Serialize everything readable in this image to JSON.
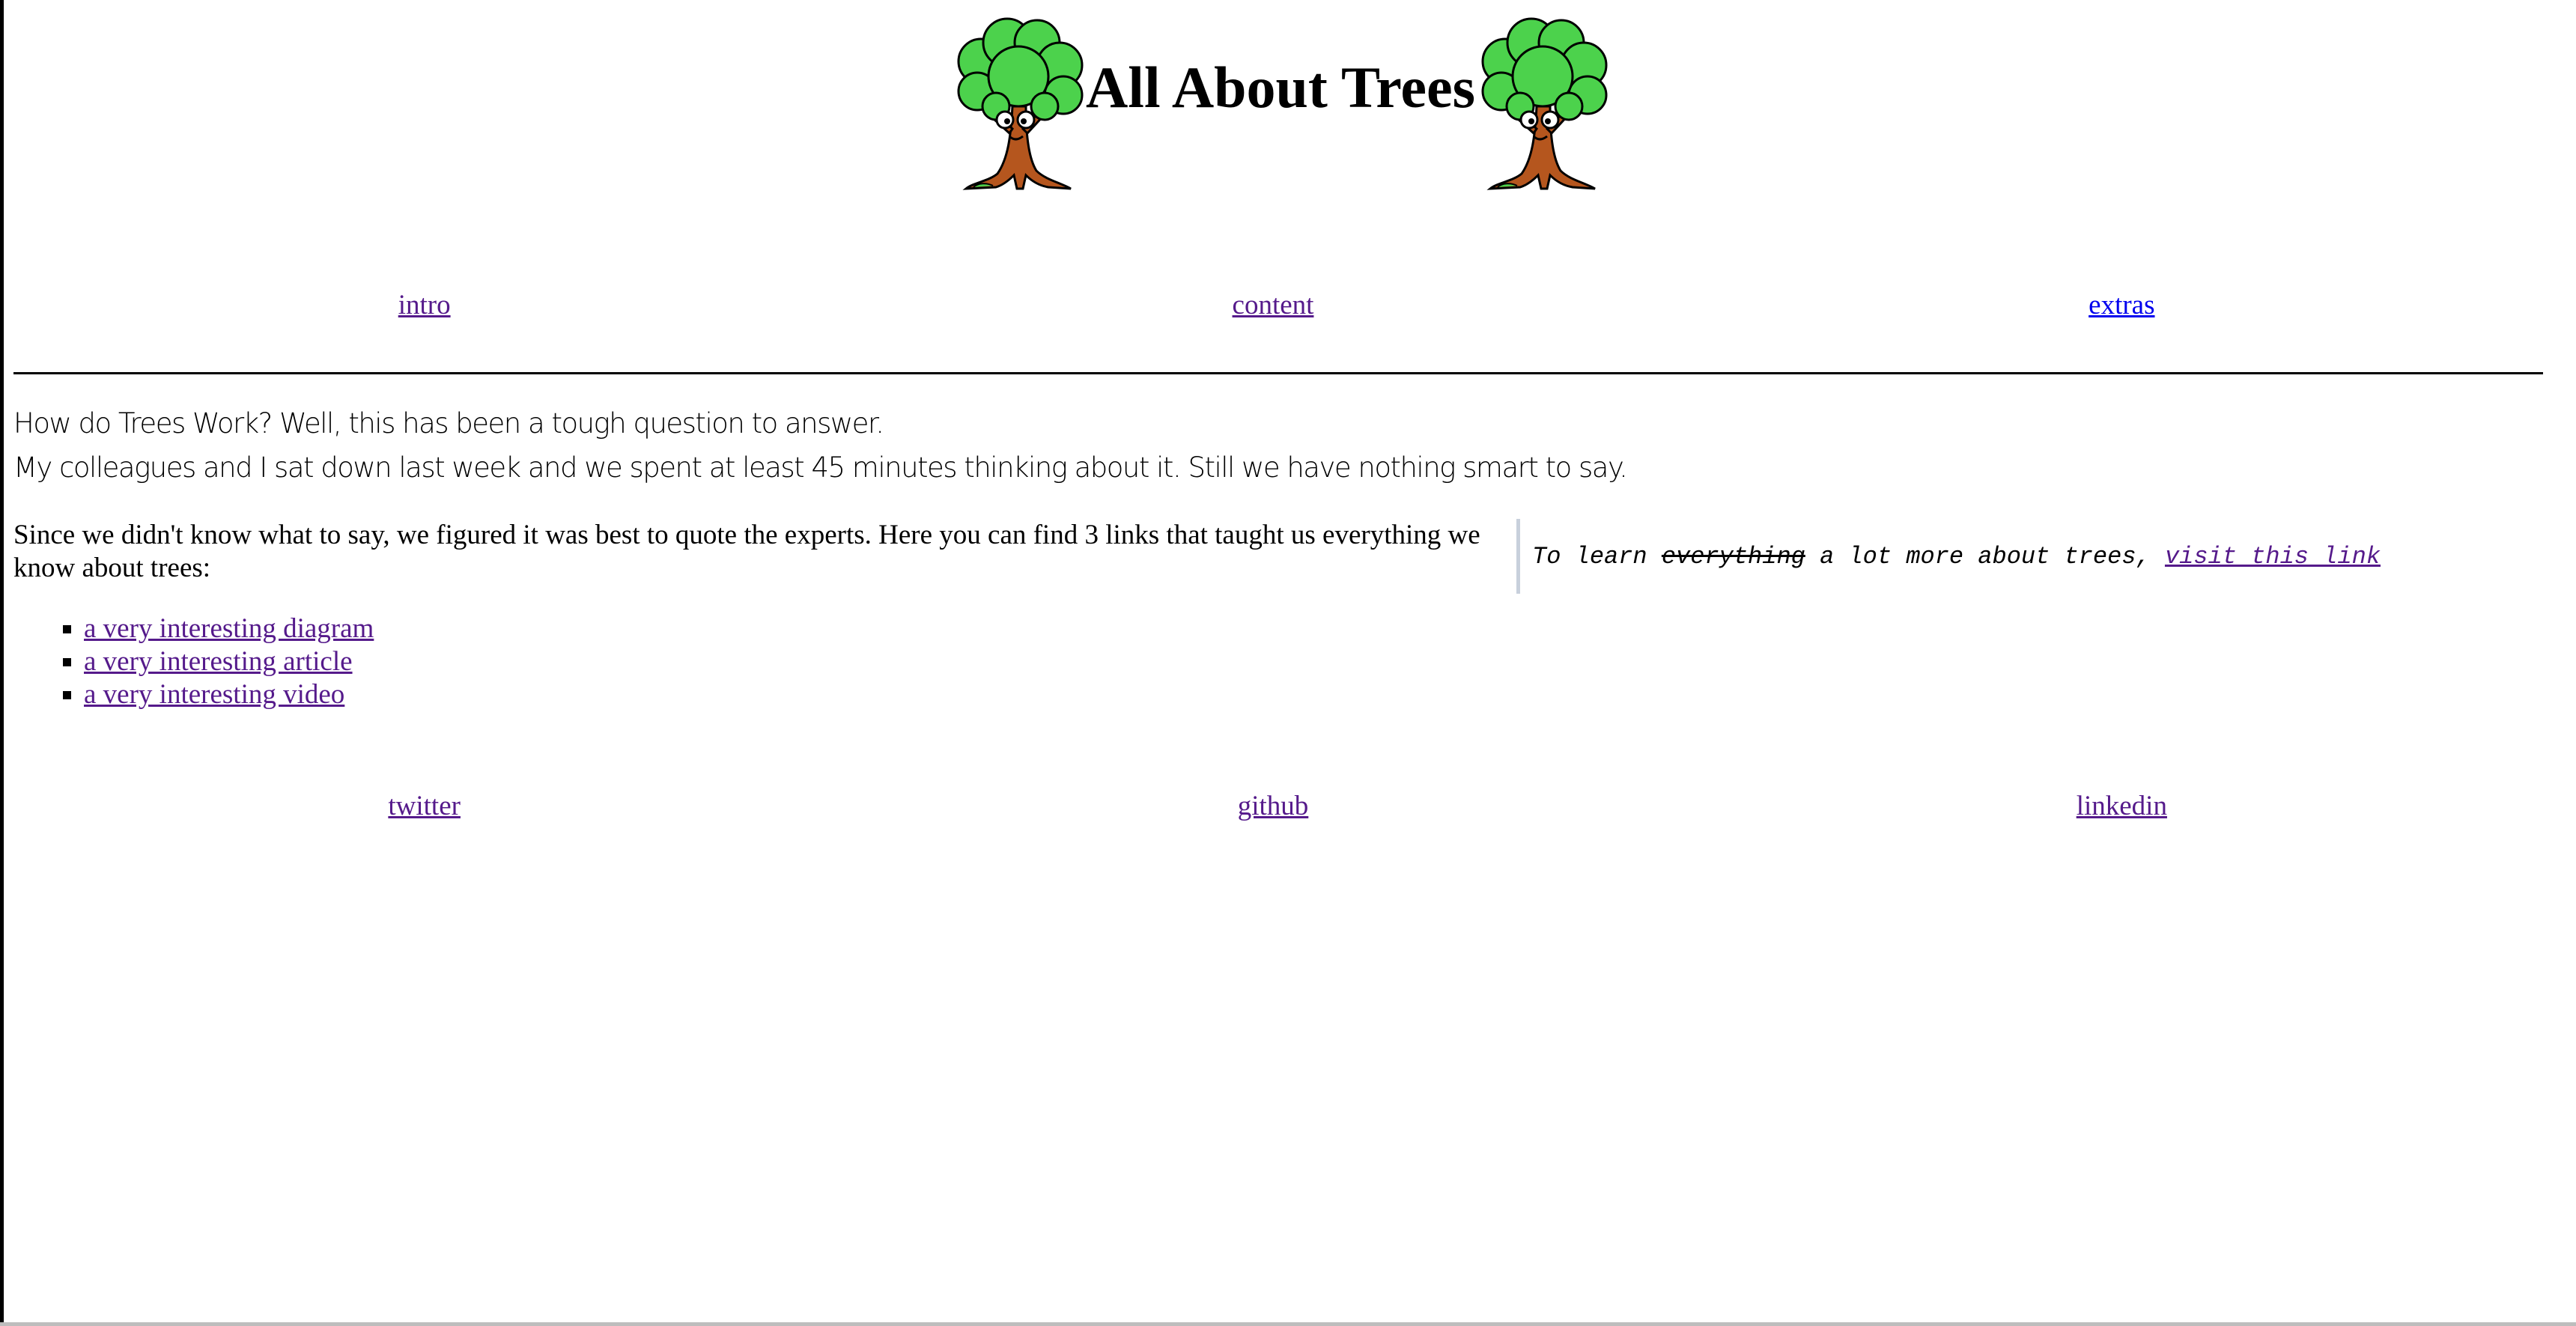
{
  "title": "All About Trees",
  "top_nav": [
    {
      "label": "intro"
    },
    {
      "label": "content"
    },
    {
      "label": "extras"
    }
  ],
  "intro": {
    "line1": "How do Trees Work? Well, this has been a tough question to answer.",
    "line2": "My colleagues and I sat down last week and we spent at least 45 minutes thinking about it. Still we have nothing smart to say."
  },
  "experts_text": "Since we didn't know what to say, we figured it was best to quote the experts. Here you can find 3 links that taught us everything we know about trees:",
  "quote": {
    "prefix": "To learn ",
    "struck": "everything",
    "middle": " a lot more about trees, ",
    "link": "visit this link"
  },
  "resource_links": [
    {
      "label": "a very interesting diagram"
    },
    {
      "label": "a very interesting article"
    },
    {
      "label": "a very interesting video"
    }
  ],
  "social_nav": [
    {
      "label": "twitter"
    },
    {
      "label": "github"
    },
    {
      "label": "linkedin"
    }
  ],
  "colors": {
    "visited_link": "#551a8b",
    "link": "#0000ee",
    "tree_foliage": "#4cd24c",
    "tree_trunk": "#b5561e"
  },
  "icons": [
    "tree-mascot-icon"
  ]
}
